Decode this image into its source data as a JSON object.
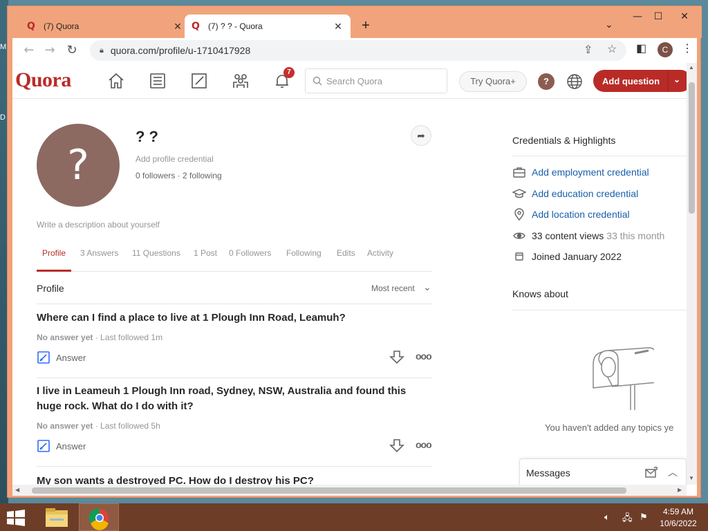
{
  "desktop": {
    "left_letters": [
      "M",
      "D"
    ]
  },
  "browser": {
    "tabs": [
      {
        "title": "(7) Quora",
        "active": false
      },
      {
        "title": "(7) ? ? - Quora",
        "active": true
      }
    ],
    "new_tab": "+",
    "url": "quora.com/profile/u-1710417928",
    "profile_initial": "C"
  },
  "quora": {
    "logo": "Quora",
    "notification_count": "7",
    "search_placeholder": "Search Quora",
    "try_plus": "Try Quora+",
    "avatar_initial": "?",
    "add_question": "Add question",
    "profile": {
      "name": "? ?",
      "avatar_glyph": "?",
      "credential": "Add profile credential",
      "follow_stats": "0 followers · 2 following",
      "description": "Write a description about yourself"
    },
    "tabs": [
      "Profile",
      "3 Answers",
      "11 Questions",
      "1 Post",
      "0 Followers",
      "Following",
      "Edits",
      "Activity"
    ],
    "section_title": "Profile",
    "sort_label": "Most recent",
    "questions": [
      {
        "title": "Where can I find a place to live at 1 Plough Inn Road, Leamuh?",
        "status": "No answer yet",
        "followed": " · Last followed 1m",
        "answer_label": "Answer",
        "more": "ooo"
      },
      {
        "title": "I live in Leameuh 1 Plough Inn road, Sydney, NSW, Australia and found this huge rock. What do I do with it?",
        "status": "No answer yet",
        "followed": " · Last followed 5h",
        "answer_label": "Answer",
        "more": "ooo"
      },
      {
        "title": "My son wants a destroyed PC. How do I destroy his PC?"
      }
    ],
    "sidebar": {
      "credentials_title": "Credentials & Highlights",
      "employment": "Add employment credential",
      "education": "Add education credential",
      "location": "Add location credential",
      "views": "33 content views",
      "views_month": "33 this month",
      "joined": "Joined January 2022",
      "knows_title": "Knows about",
      "no_topics": "You haven't added any topics ye"
    },
    "messages": {
      "label": "Messages"
    }
  },
  "taskbar": {
    "time": "4:59 AM",
    "date": "10/6/2022"
  },
  "colors": {
    "quora_red": "#b92b27",
    "link_blue": "#195faa",
    "tabstrip": "#f1a47b",
    "taskbar": "#6e3d28"
  }
}
